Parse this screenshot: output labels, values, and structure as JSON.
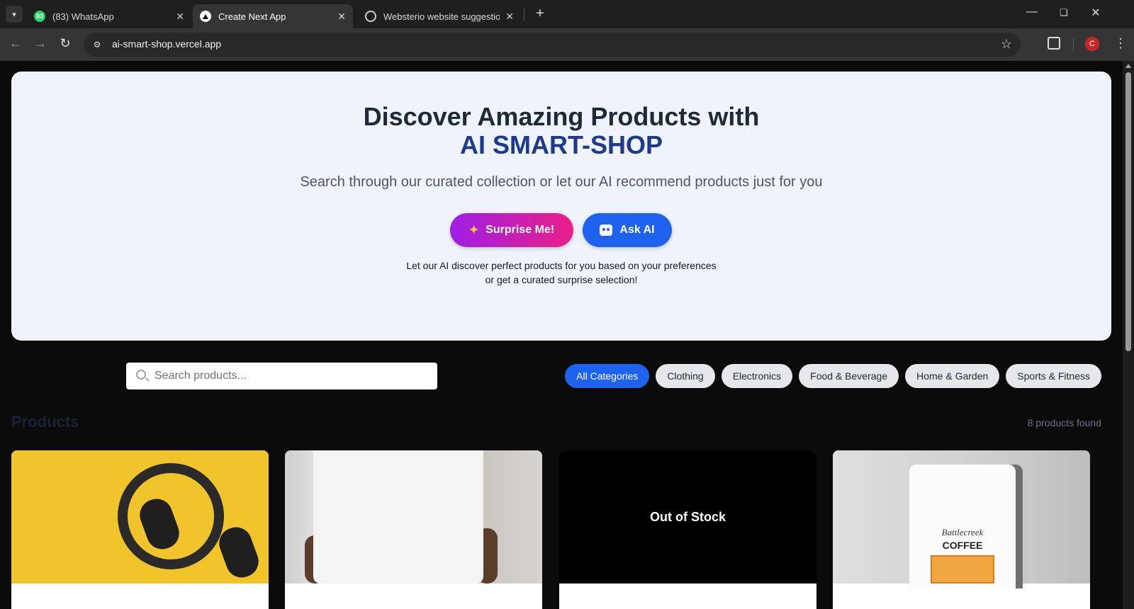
{
  "browser": {
    "tabs": [
      {
        "label": "(83) WhatsApp",
        "badge": "83",
        "active": false
      },
      {
        "label": "Create Next App",
        "active": true
      },
      {
        "label": "Websterio website suggestions",
        "active": false
      }
    ],
    "url": "ai-smart-shop.vercel.app",
    "profile_initial": "C"
  },
  "hero": {
    "title": "Discover Amazing Products with",
    "brand": "AI SMART-SHOP",
    "subtitle": "Search through our curated collection or let our AI recommend products just for you",
    "surprise_label": "Surprise Me!",
    "ask_label": "Ask AI",
    "note_line1": "Let our AI discover perfect products for you based on your preferences",
    "note_line2": "or get a curated surprise selection!"
  },
  "search": {
    "placeholder": "Search products..."
  },
  "categories": [
    "All Categories",
    "Clothing",
    "Electronics",
    "Food & Beverage",
    "Home & Garden",
    "Sports & Fitness"
  ],
  "products": {
    "title": "Products",
    "count_text": "8 products found",
    "cards": [
      {
        "image": "headphones"
      },
      {
        "image": "white t-shirt"
      },
      {
        "image": "out of stock",
        "status": "Out of Stock"
      },
      {
        "image": "coffee bag",
        "brand": "Battlecreek",
        "product": "COFFEE"
      }
    ]
  },
  "colors": {
    "accent": "#1d63f0",
    "brand": "#1e3a8a",
    "gradient_start": "#9d1fe6",
    "gradient_end": "#ec1f89"
  }
}
